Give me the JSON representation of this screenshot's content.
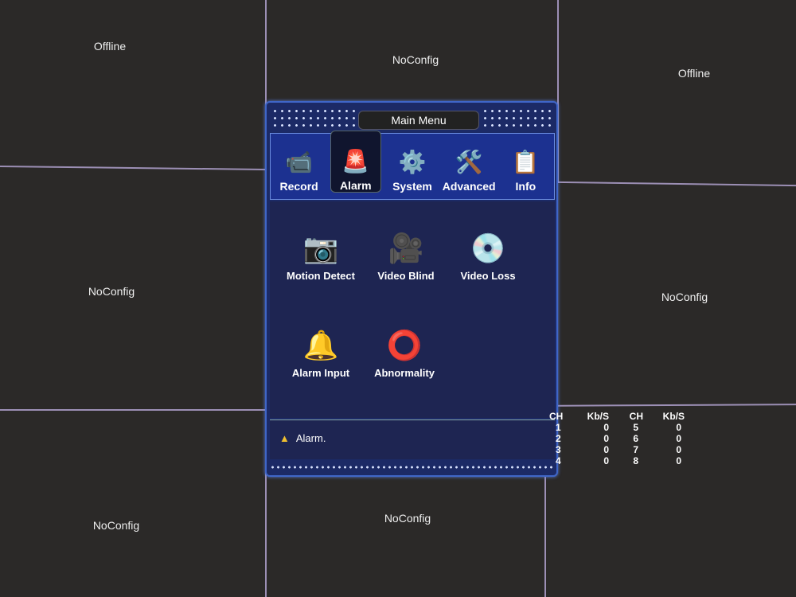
{
  "tiles": [
    "Offline",
    "NoConfig",
    "Offline",
    "NoConfig",
    "NoConfig",
    "NoConfig",
    "NoConfig"
  ],
  "menu": {
    "title": "Main Menu",
    "tabs": [
      {
        "label": "Record",
        "icon": "camera-icon"
      },
      {
        "label": "Alarm",
        "icon": "alarm-bell-icon",
        "active": true
      },
      {
        "label": "System",
        "icon": "gear-icon"
      },
      {
        "label": "Advanced",
        "icon": "tools-icon"
      },
      {
        "label": "Info",
        "icon": "info-icon"
      }
    ],
    "items": [
      {
        "label": "Motion Detect",
        "icon": "motion-camera-icon"
      },
      {
        "label": "Video Blind",
        "icon": "video-blind-icon"
      },
      {
        "label": "Video Loss",
        "icon": "video-loss-disc-icon"
      },
      {
        "label": "Alarm Input",
        "icon": "alarm-input-icon"
      },
      {
        "label": "Abnormality",
        "icon": "abnormality-icon"
      }
    ],
    "status": "Alarm."
  },
  "bitrate": {
    "headers": [
      "CH",
      "Kb/S",
      "CH",
      "Kb/S"
    ],
    "rows": [
      [
        "1",
        "0",
        "5",
        "0"
      ],
      [
        "2",
        "0",
        "6",
        "0"
      ],
      [
        "3",
        "0",
        "7",
        "0"
      ],
      [
        "4",
        "0",
        "8",
        "0"
      ]
    ]
  }
}
